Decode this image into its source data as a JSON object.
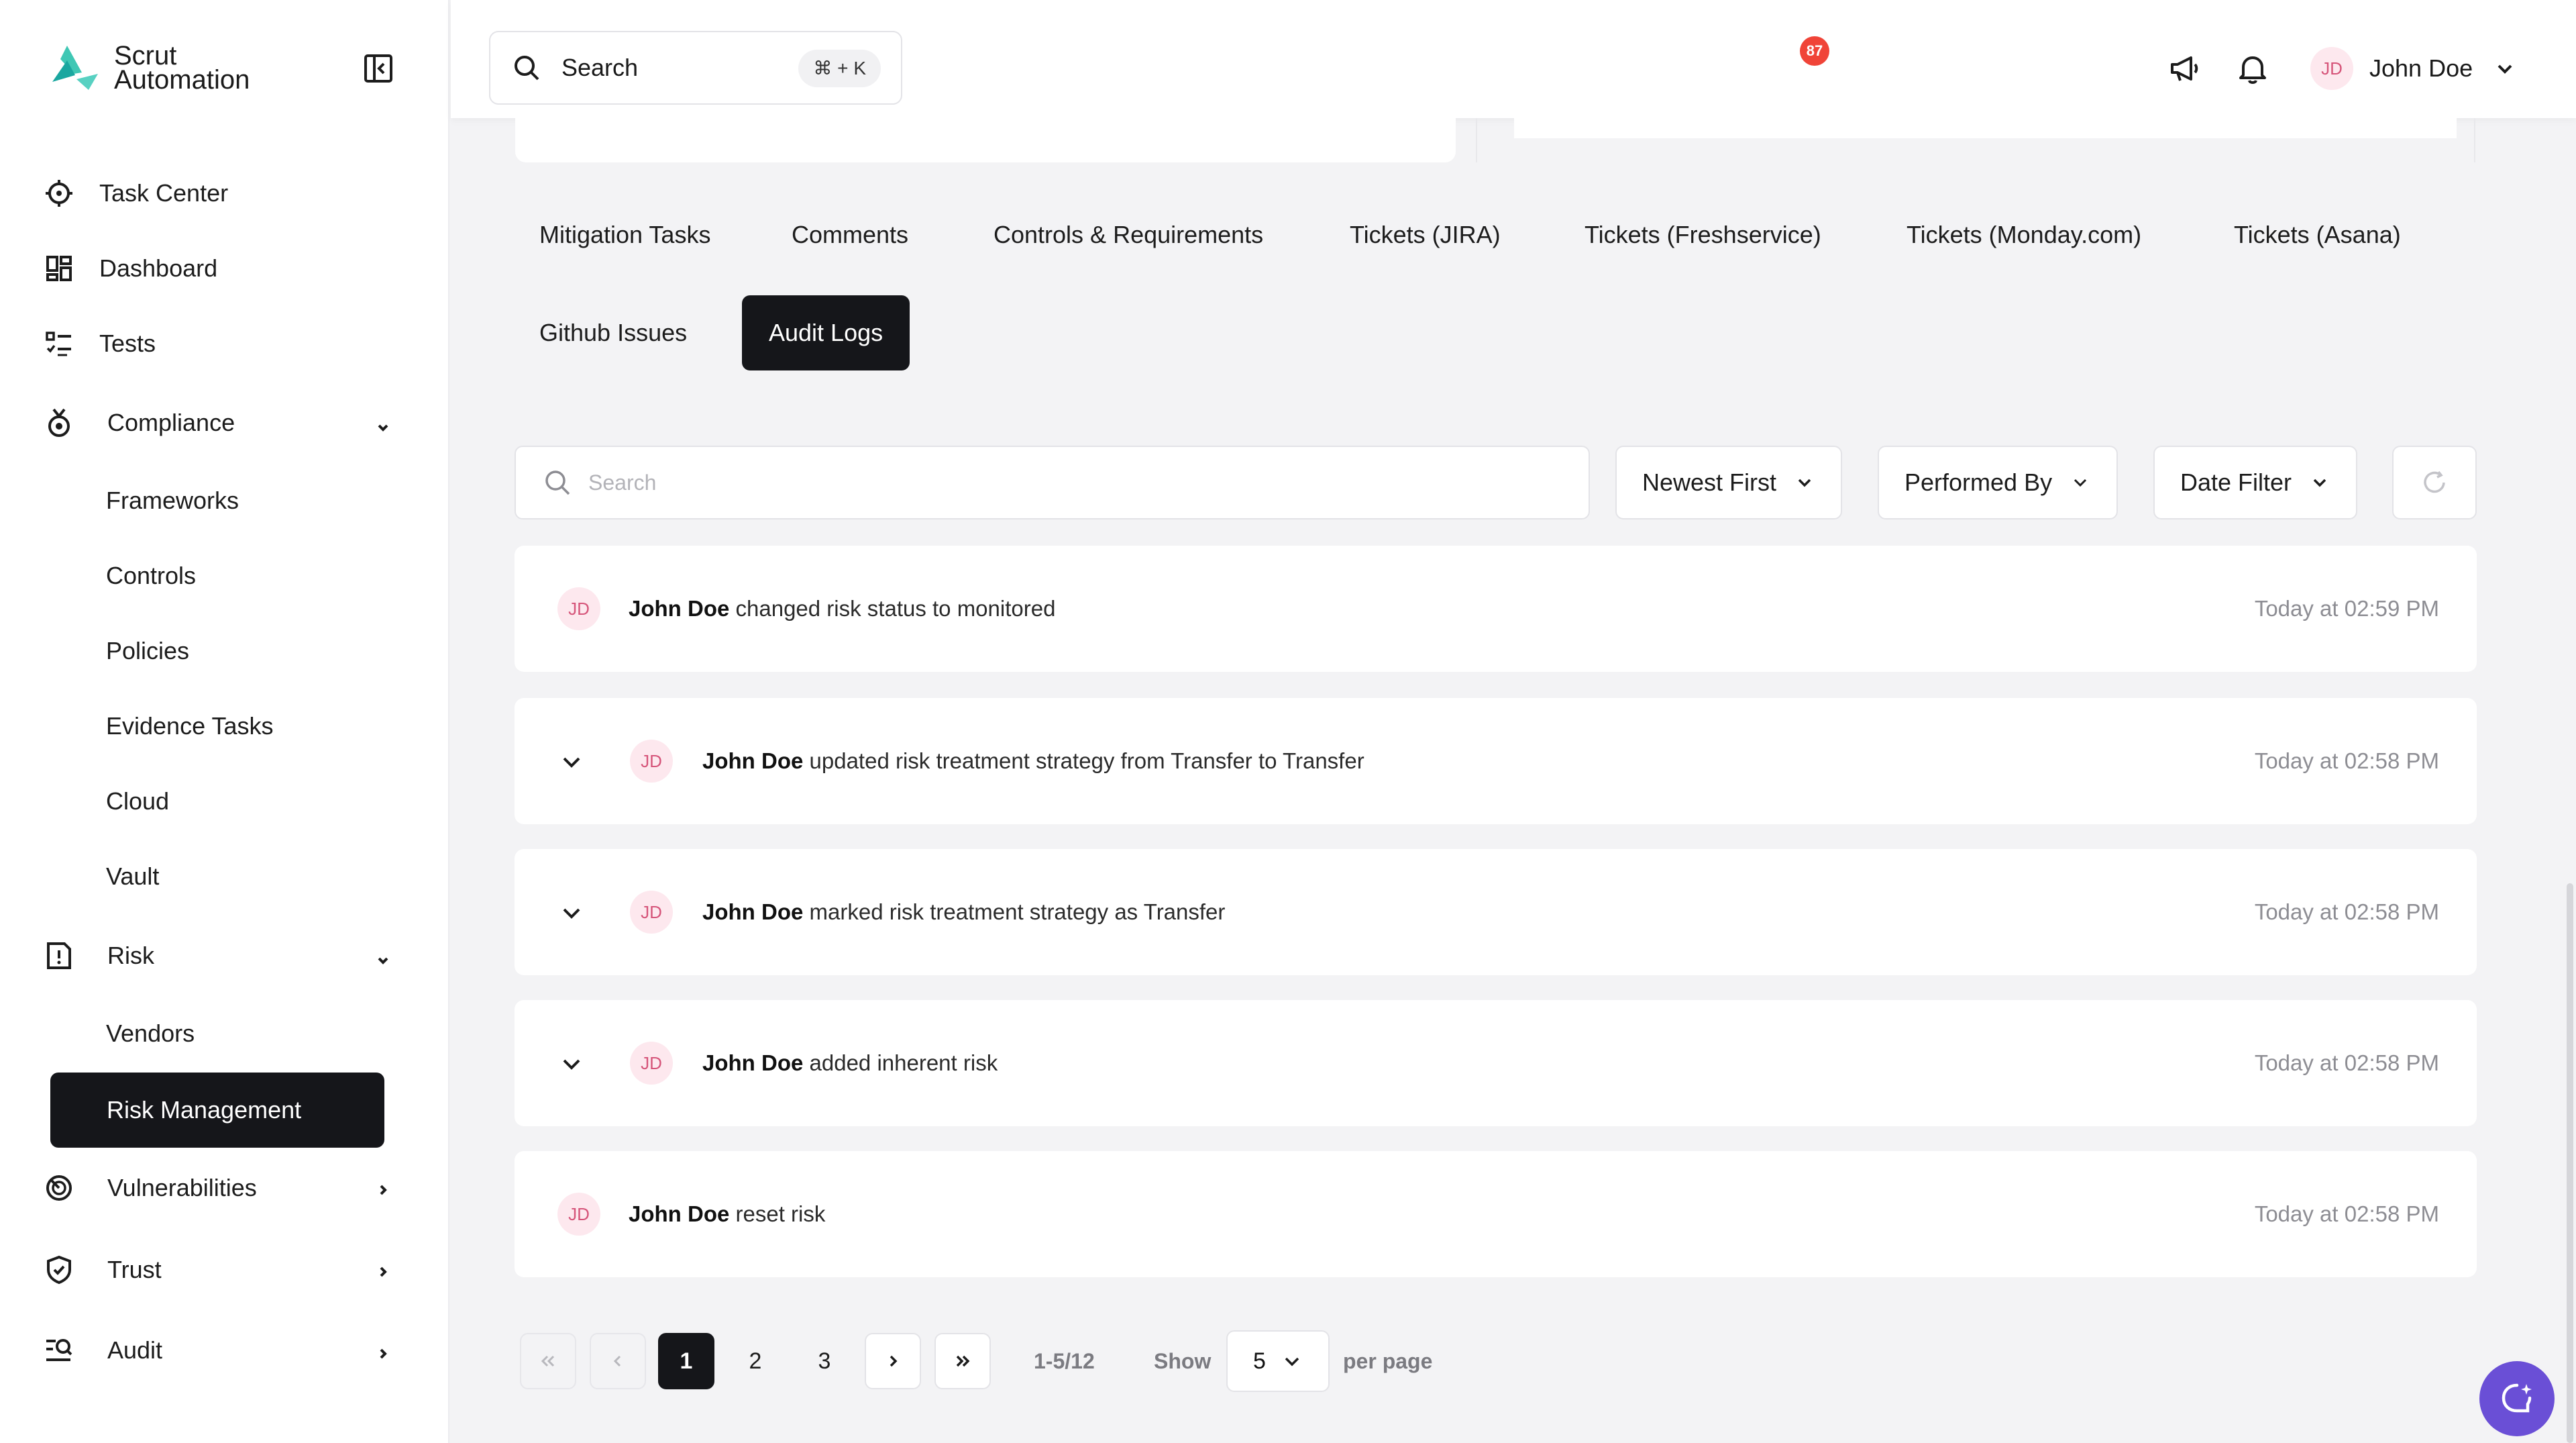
{
  "brand": {
    "line1": "Scrut",
    "line2": "Automation"
  },
  "sidebar": {
    "items": [
      {
        "label": "Task Center"
      },
      {
        "label": "Dashboard"
      },
      {
        "label": "Tests"
      },
      {
        "label": "Compliance"
      },
      {
        "label": "Frameworks"
      },
      {
        "label": "Controls"
      },
      {
        "label": "Policies"
      },
      {
        "label": "Evidence Tasks"
      },
      {
        "label": "Cloud"
      },
      {
        "label": "Vault"
      },
      {
        "label": "Risk"
      },
      {
        "label": "Vendors"
      },
      {
        "label": "Risk Management"
      },
      {
        "label": "Vulnerabilities"
      },
      {
        "label": "Trust"
      },
      {
        "label": "Audit"
      }
    ],
    "active_item": "Risk Management"
  },
  "topbar": {
    "search_label": "Search",
    "search_shortcut": "⌘ + K",
    "notification_count": "87",
    "user_initials": "JD",
    "user_name": "John Doe"
  },
  "tabs": [
    {
      "label": "Mitigation Tasks"
    },
    {
      "label": "Comments"
    },
    {
      "label": "Controls & Requirements"
    },
    {
      "label": "Tickets (JIRA)"
    },
    {
      "label": "Tickets (Freshservice)"
    },
    {
      "label": "Tickets (Monday.com)"
    },
    {
      "label": "Tickets (Asana)"
    },
    {
      "label": "Github Issues"
    },
    {
      "label": "Audit Logs"
    }
  ],
  "active_tab": "Audit Logs",
  "filters": {
    "search_placeholder": "Search",
    "sort": "Newest First",
    "performed_by": "Performed By",
    "date_filter": "Date Filter"
  },
  "logs": [
    {
      "initials": "JD",
      "actor": "John Doe",
      "action": "changed risk status to monitored",
      "time": "Today at 02:59 PM",
      "expandable": false
    },
    {
      "initials": "JD",
      "actor": "John Doe",
      "action": "updated risk treatment strategy from Transfer to Transfer",
      "time": "Today at 02:58 PM",
      "expandable": true
    },
    {
      "initials": "JD",
      "actor": "John Doe",
      "action": "marked risk treatment strategy as Transfer",
      "time": "Today at 02:58 PM",
      "expandable": true
    },
    {
      "initials": "JD",
      "actor": "John Doe",
      "action": "added inherent risk",
      "time": "Today at 02:58 PM",
      "expandable": true
    },
    {
      "initials": "JD",
      "actor": "John Doe",
      "action": "reset risk",
      "time": "Today at 02:58 PM",
      "expandable": false
    }
  ],
  "pagination": {
    "pages": [
      "1",
      "2",
      "3"
    ],
    "current_page": "1",
    "range": "1-5/12",
    "show_label": "Show",
    "per_page_value": "5",
    "per_page_label": "per page"
  },
  "colors": {
    "active_bg": "#15161a",
    "badge": "#f04438",
    "avatar_bg": "#fde8ee",
    "avatar_text": "#d6557a",
    "chat_fab": "#6a4fd6"
  }
}
